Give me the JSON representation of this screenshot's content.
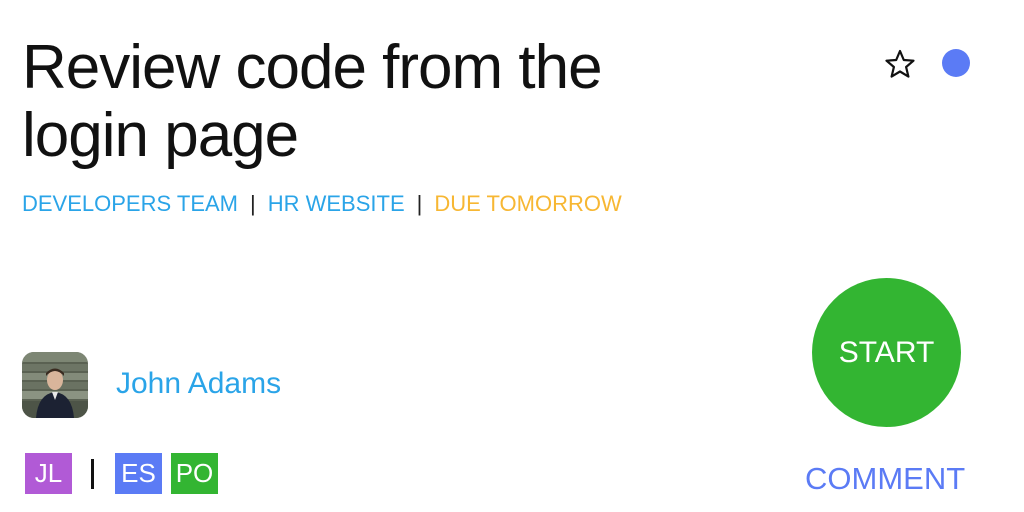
{
  "task": {
    "title": "Review code from the login page",
    "team": "DEVELOPERS TEAM",
    "project": "HR WEBSITE",
    "due": "DUE TOMORROW",
    "separator": "|"
  },
  "header_icons": {
    "favorite_icon": "star-outline-icon",
    "status_dot_color": "#5b7bf5"
  },
  "assignee": {
    "name": "John Adams",
    "avatar_icon": "profile-photo"
  },
  "collaborators": {
    "primary": [
      {
        "initials": "JL",
        "color": "#b15ad6"
      }
    ],
    "divider": "|",
    "others": [
      {
        "initials": "ES",
        "color": "#5b7bf5"
      },
      {
        "initials": "PO",
        "color": "#33b532"
      }
    ]
  },
  "actions": {
    "start_label": "START",
    "comment_label": "COMMENT"
  },
  "colors": {
    "title": "#111111",
    "team": "#2aa4e8",
    "project": "#2aa4e8",
    "due": "#f7b733",
    "assignee": "#2aa4e8",
    "start_bg": "#33b532",
    "comment": "#5b7bf5"
  }
}
